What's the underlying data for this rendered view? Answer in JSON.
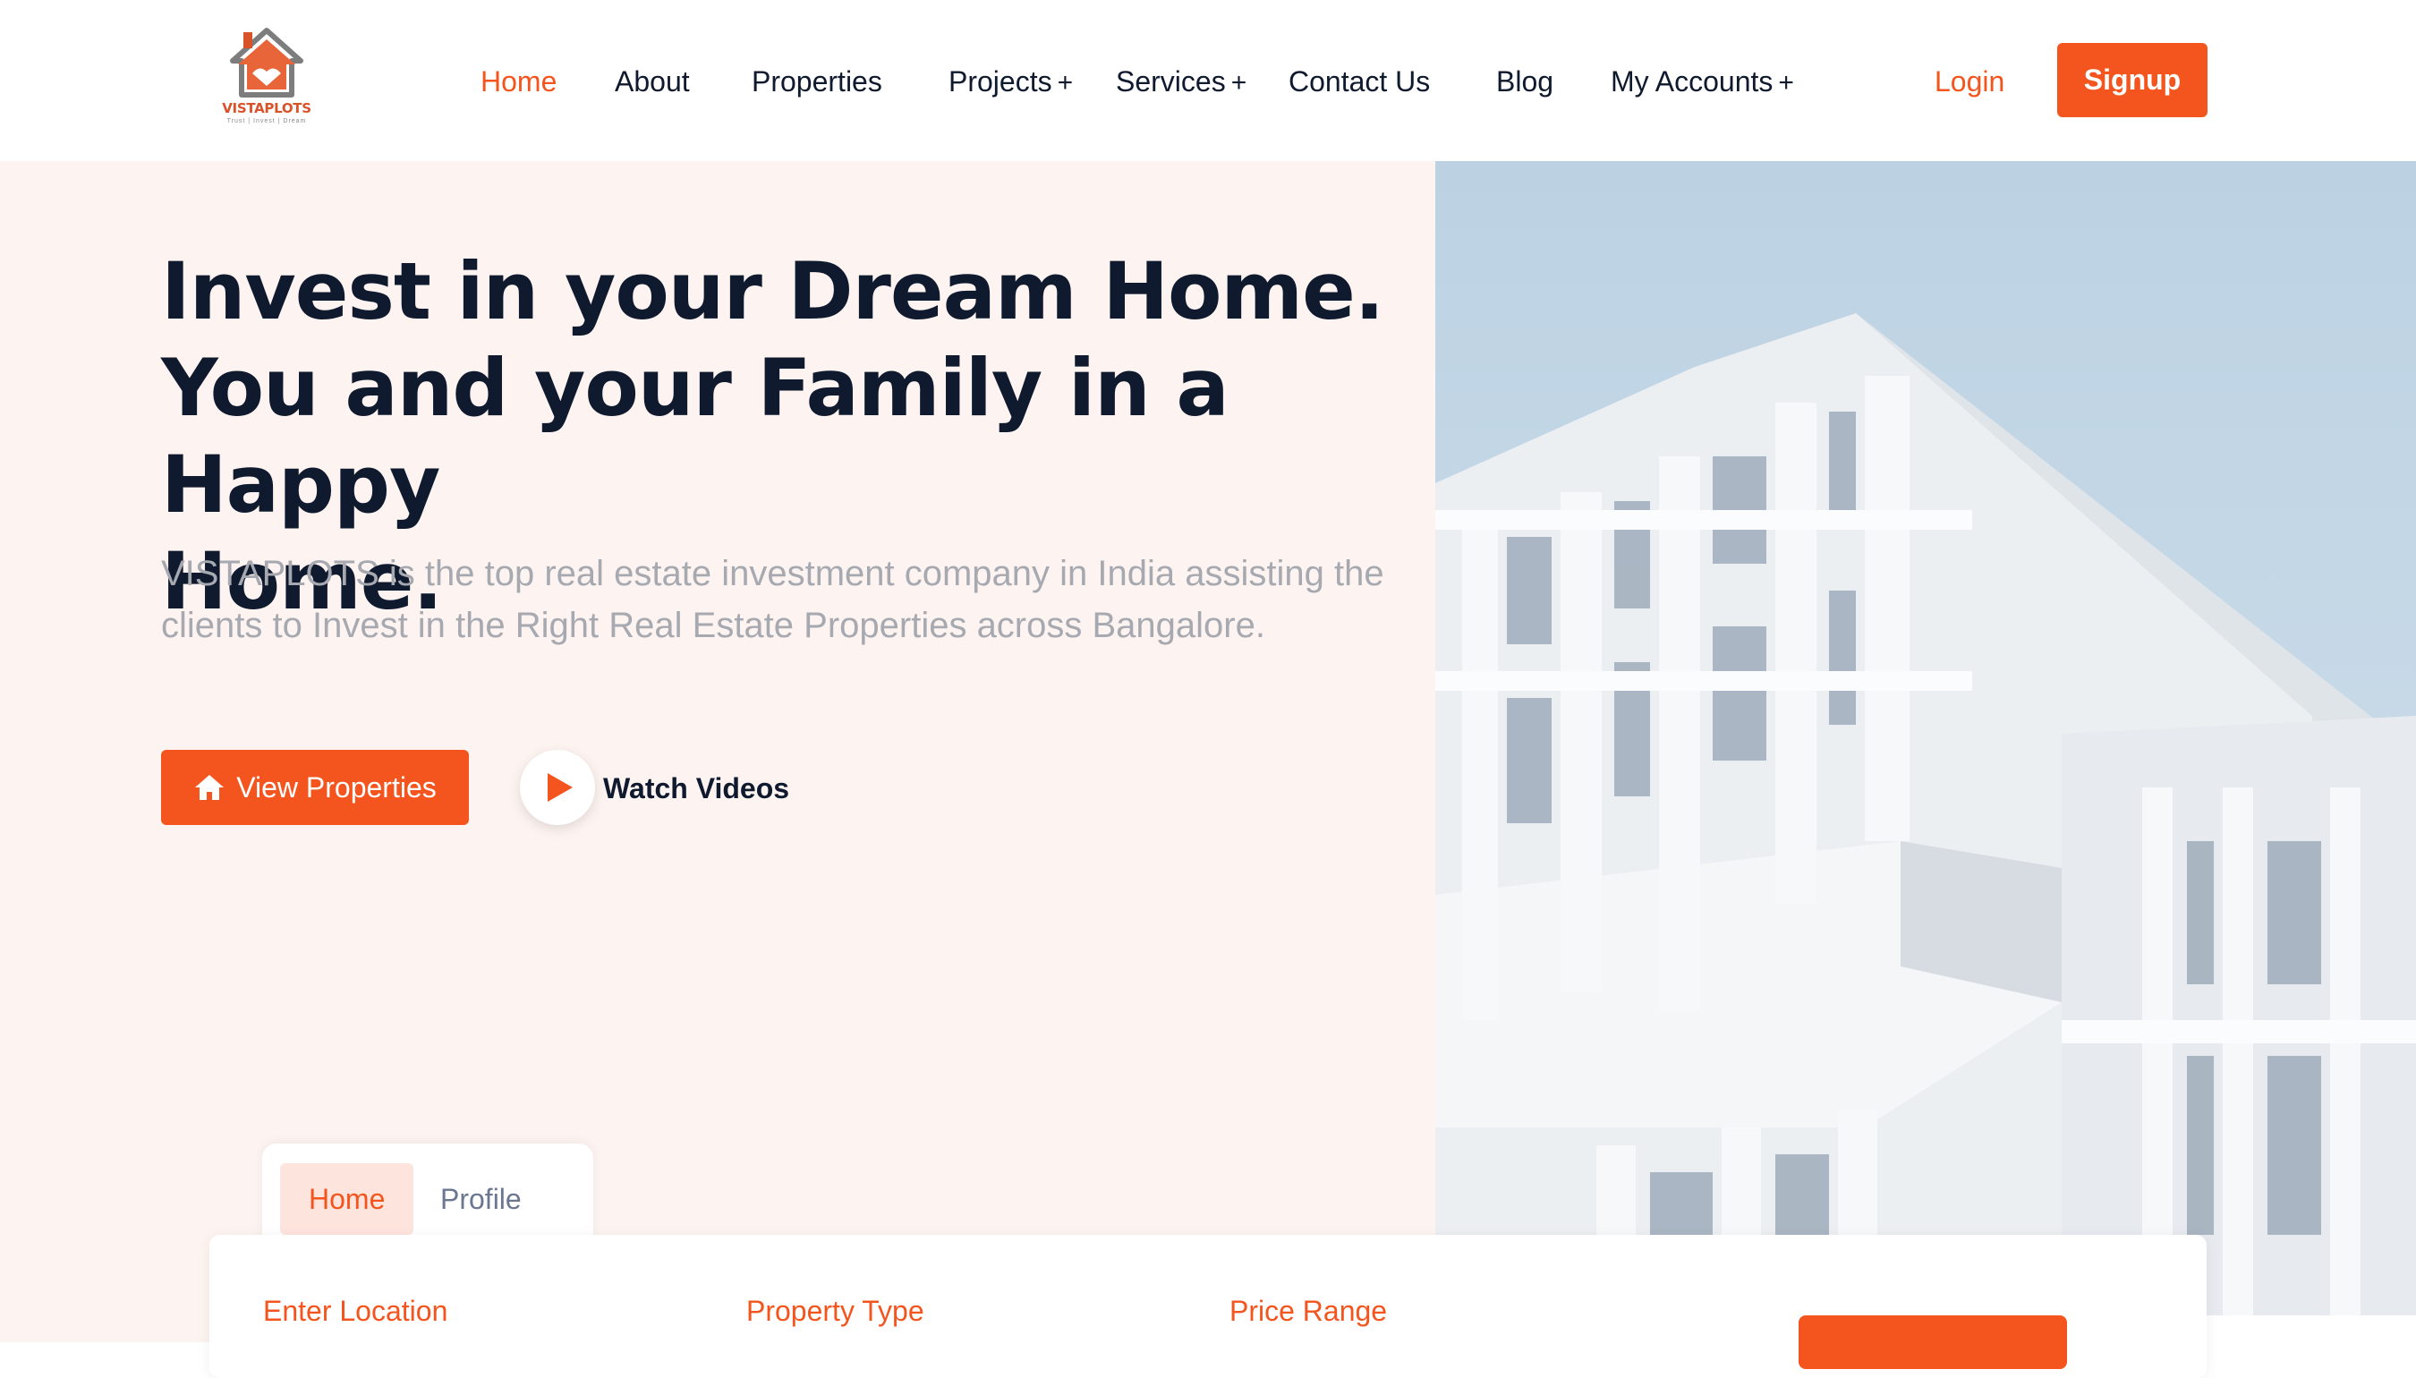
{
  "brand": {
    "name": "VISTAPLOTS",
    "tagline": "Trust | Invest | Dream",
    "accent_color": "#f4541d",
    "dark_text": "#0f1a2e"
  },
  "nav": {
    "items": [
      {
        "label": "Home",
        "active": true,
        "dropdown": false
      },
      {
        "label": "About",
        "active": false,
        "dropdown": false
      },
      {
        "label": "Properties",
        "active": false,
        "dropdown": false
      },
      {
        "label": "Projects",
        "active": false,
        "dropdown": true
      },
      {
        "label": "Services",
        "active": false,
        "dropdown": true
      },
      {
        "label": "Contact Us",
        "active": false,
        "dropdown": false
      },
      {
        "label": "Blog",
        "active": false,
        "dropdown": false
      },
      {
        "label": "My Accounts",
        "active": false,
        "dropdown": true
      }
    ],
    "dropdown_marker": "+",
    "login_label": "Login",
    "signup_label": "Signup"
  },
  "hero": {
    "headline_line1": "Invest in your Dream Home.",
    "headline_line2": "You and your Family in a Happy",
    "headline_line3": "Home.",
    "description": "VISTAPLOTS is the top real estate investment company in India assisting the clients to Invest in the Right Real Estate Properties across Bangalore.",
    "primary_button": "View Properties",
    "primary_button_icon": "home-icon",
    "video_button": "Watch Videos",
    "video_button_icon": "play-icon",
    "image": "white-modern-building"
  },
  "search": {
    "tabs": [
      "Home",
      "Profile"
    ],
    "active_tab": "Home",
    "fields": {
      "location": "Enter Location",
      "type": "Property Type",
      "price": "Price Range"
    }
  }
}
